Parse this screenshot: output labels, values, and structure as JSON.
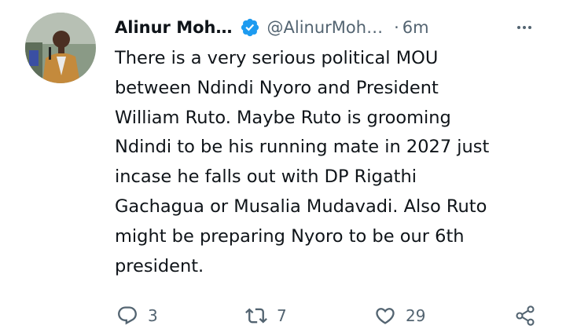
{
  "tweet": {
    "author": {
      "display_name": "Alinur Moh…",
      "handle": "@AlinurMoh…",
      "verified": true,
      "verified_color": "#1d9bf0",
      "avatar_icon": "avatar-photo"
    },
    "separator": "·",
    "time": "6m",
    "text": "There is a very serious political MOU\nbetween Ndindi Nyoro and President\nWilliam Ruto. Maybe Ruto is grooming\nNdindi to be his running mate in 2027 just\nincase he falls out with DP Rigathi\nGachagua or Musalia Mudavadi. Also Ruto\nmight be preparing Nyoro to be our 6th\npresident.",
    "actions": {
      "reply_count": "3",
      "retweet_count": "7",
      "like_count": "29"
    }
  },
  "colors": {
    "text": "#0f1419",
    "secondary": "#536471",
    "accent": "#1d9bf0"
  }
}
